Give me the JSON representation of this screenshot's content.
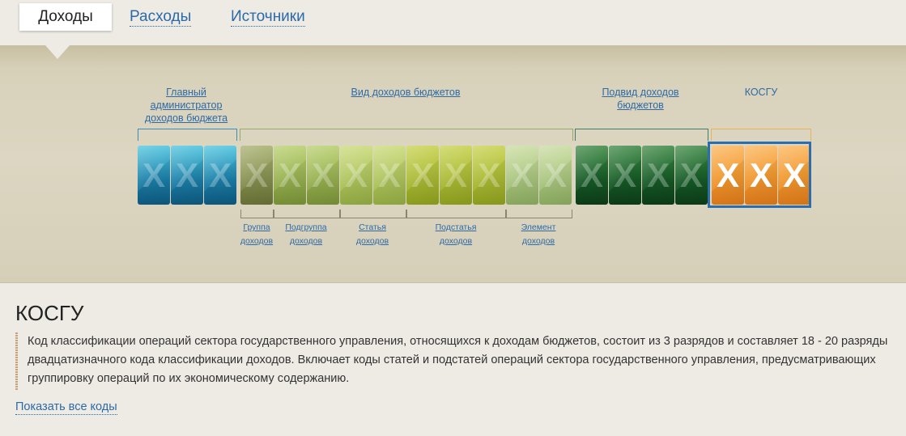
{
  "tabs": [
    {
      "label": "Доходы",
      "active": true
    },
    {
      "label": "Расходы",
      "active": false
    },
    {
      "label": "Источники",
      "active": false
    }
  ],
  "diagram": {
    "groups": {
      "admin": "Главный администратор доходов бюджета",
      "kind": "Вид доходов бюджетов",
      "subkind": "Подвид доходов бюджетов",
      "kosgu": "КОСГУ"
    },
    "subgroups": {
      "group": "Группа доходов",
      "subgroup": "Подгруппа доходов",
      "article": "Статья доходов",
      "subarticle": "Подстатья доходов",
      "element": "Элемент доходов"
    },
    "digit_char": "X",
    "colors": {
      "admin": "#1f8db5",
      "kind_dark": "#7d8a45",
      "kind_light": "#a9c560",
      "subkind": "#1e6a2e",
      "kosgu": "#f29a30",
      "selected_border": "#2a6eb0"
    }
  },
  "description": {
    "title": "КОСГУ",
    "lines": [
      "Код классификации операций сектора государственного управления, относящихся к доходам бюджетов, состоит из 3 разрядов и составляет 18 - 20 разряды",
      "двадцатизначного кода классификации доходов. Включает коды статей и подстатей операций сектора государственного управления, предусматривающих",
      "группировку операций по их экономическому содержанию."
    ],
    "show_all": "Показать все коды"
  }
}
